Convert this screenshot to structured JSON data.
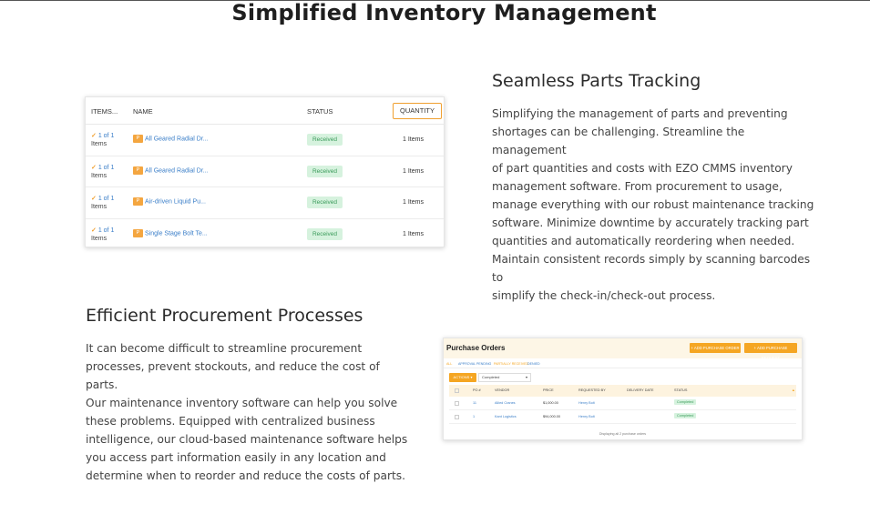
{
  "page": {
    "title": "Simplified Inventory Management"
  },
  "section1": {
    "title": "Seamless Parts Tracking",
    "paragraph_lines": [
      "Simplifying the management of parts and preventing",
      "shortages can be challenging. Streamline the management",
      "of part quantities and costs with EZO CMMS inventory",
      "management software. From procurement to usage,",
      "manage everything with our robust maintenance tracking",
      "software. Minimize downtime by accurately tracking part",
      "quantities and automatically reordering when needed.",
      "Maintain consistent records simply by scanning barcodes to",
      "simplify the check-in/check-out process."
    ]
  },
  "section2": {
    "title": "Efficient Procurement Processes",
    "paragraph_lines": [
      "It can become difficult to streamline procurement",
      "processes, prevent stockouts, and reduce the cost of parts.",
      "Our maintenance inventory software can help you solve",
      "these problems. Equipped with centralized business",
      "intelligence, our cloud-based maintenance software helps",
      "you access part information easily in any location and",
      "determine when to reorder and reduce the costs of parts."
    ]
  },
  "items_table": {
    "headers": {
      "items": "ITEMS...",
      "name": "NAME",
      "status": "STATUS",
      "quantity": "QUANTITY"
    },
    "rows": [
      {
        "check": "✓",
        "count": "1 of 1",
        "items_word": "Items",
        "badge": "P",
        "name": "All Geared Radial Dr...",
        "status": "Received",
        "quantity": "1 Items"
      },
      {
        "check": "✓",
        "count": "1 of 1",
        "items_word": "Items",
        "badge": "P",
        "name": "All Geared Radial Dr...",
        "status": "Received",
        "quantity": "1 Items"
      },
      {
        "check": "✓",
        "count": "1 of 1",
        "items_word": "Items",
        "badge": "P",
        "name": "Air-driven Liquid Pu...",
        "status": "Received",
        "quantity": "1 Items"
      },
      {
        "check": "✓",
        "count": "1 of 1",
        "items_word": "Items",
        "badge": "P",
        "name": "Single Stage Bolt Te...",
        "status": "Received",
        "quantity": "1 Items"
      }
    ]
  },
  "purchase_orders": {
    "title": "Purchase Orders",
    "buttons": {
      "add_order": "+ ADD PURCHASE ORDER",
      "add_request": "+ ADD PURCHASE REQUEST"
    },
    "tabs": [
      "ALL",
      "APPROVAL PENDING",
      "PARTIALLY RECEIVED",
      "DENIED"
    ],
    "actions_label": "ACTIONS ▾",
    "filter_value": "Completed",
    "columns": [
      "PO #",
      "VENDOR",
      "PRICE",
      "REQUESTED BY",
      "DELIVERY DATE",
      "STATUS"
    ],
    "rows": [
      {
        "po": "11",
        "vendor": "Allied Cranes",
        "price": "$1,000.00",
        "requested_by": "Henry Bolt",
        "delivery": "",
        "status": "Completed"
      },
      {
        "po": "1",
        "vendor": "Kant Logistics",
        "price": "$94,000.00",
        "requested_by": "Henry Bolt",
        "delivery": "",
        "status": "Completed"
      }
    ],
    "footer": "Displaying all 2 purchase orders"
  },
  "colors": {
    "accent_orange": "#f5a623",
    "link_blue": "#3a7ec8",
    "status_green_bg": "#d6f2de",
    "status_green_text": "#3a9b5a"
  }
}
